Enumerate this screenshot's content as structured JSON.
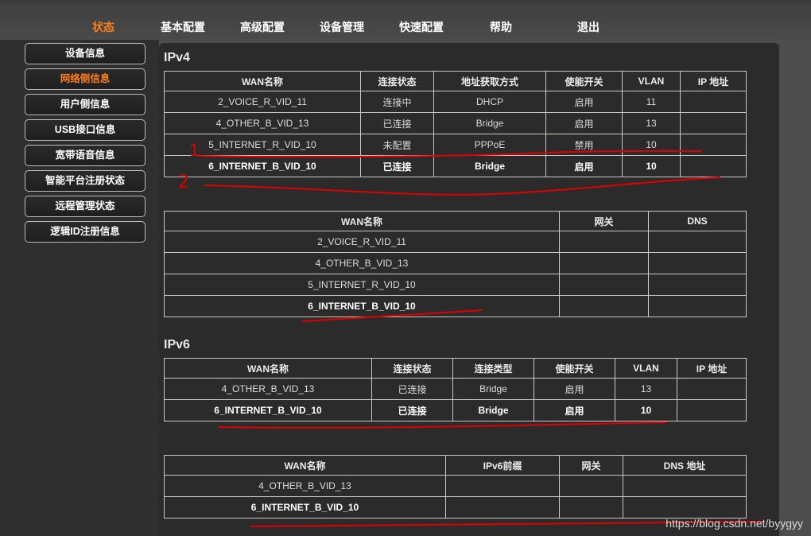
{
  "nav": {
    "items": [
      {
        "label": "状态",
        "active": true
      },
      {
        "label": "基本配置"
      },
      {
        "label": "高级配置"
      },
      {
        "label": "设备管理"
      },
      {
        "label": "快速配置"
      },
      {
        "label": "帮助"
      },
      {
        "label": "退出"
      }
    ]
  },
  "sidebar": {
    "items": [
      {
        "label": "设备信息"
      },
      {
        "label": "网络侧信息",
        "active": true
      },
      {
        "label": "用户侧信息"
      },
      {
        "label": "USB接口信息"
      },
      {
        "label": "宽带语音信息"
      },
      {
        "label": "智能平台注册状态"
      },
      {
        "label": "远程管理状态"
      },
      {
        "label": "逻辑ID注册信息"
      }
    ]
  },
  "ipv4": {
    "title": "IPv4",
    "status_table": {
      "headers": [
        "WAN名称",
        "连接状态",
        "地址获取方式",
        "使能开关",
        "VLAN",
        "IP 地址"
      ],
      "rows": [
        [
          "2_VOICE_R_VID_11",
          "连接中",
          "DHCP",
          "启用",
          "11",
          ""
        ],
        [
          "4_OTHER_B_VID_13",
          "已连接",
          "Bridge",
          "启用",
          "13",
          ""
        ],
        [
          "5_INTERNET_R_VID_10",
          "未配置",
          "PPPoE",
          "禁用",
          "10",
          ""
        ],
        [
          "6_INTERNET_B_VID_10",
          "已连接",
          "Bridge",
          "启用",
          "10",
          ""
        ]
      ]
    },
    "gateway_table": {
      "headers": [
        "WAN名称",
        "网关",
        "DNS"
      ],
      "rows": [
        [
          "2_VOICE_R_VID_11",
          "",
          ""
        ],
        [
          "4_OTHER_B_VID_13",
          "",
          ""
        ],
        [
          "5_INTERNET_R_VID_10",
          "",
          ""
        ],
        [
          "6_INTERNET_B_VID_10",
          "",
          ""
        ]
      ]
    }
  },
  "ipv6": {
    "title": "IPv6",
    "status_table": {
      "headers": [
        "WAN名称",
        "连接状态",
        "连接类型",
        "使能开关",
        "VLAN",
        "IP 地址"
      ],
      "rows": [
        [
          "4_OTHER_B_VID_13",
          "已连接",
          "Bridge",
          "启用",
          "13",
          ""
        ],
        [
          "6_INTERNET_B_VID_10",
          "已连接",
          "Bridge",
          "启用",
          "10",
          ""
        ]
      ]
    },
    "prefix_table": {
      "headers": [
        "WAN名称",
        "IPv6前缀",
        "网关",
        "DNS 地址"
      ],
      "rows": [
        [
          "4_OTHER_B_VID_13",
          "",
          "",
          ""
        ],
        [
          "6_INTERNET_B_VID_10",
          "",
          "",
          ""
        ]
      ]
    }
  },
  "annotations": {
    "mark_1": "1",
    "mark_2": "2"
  },
  "watermark": "https://blog.csdn.net/byygyy",
  "colors": {
    "accent": "#ff7e1a",
    "annotation": "#e00000",
    "panel": "#2b2b2b"
  }
}
